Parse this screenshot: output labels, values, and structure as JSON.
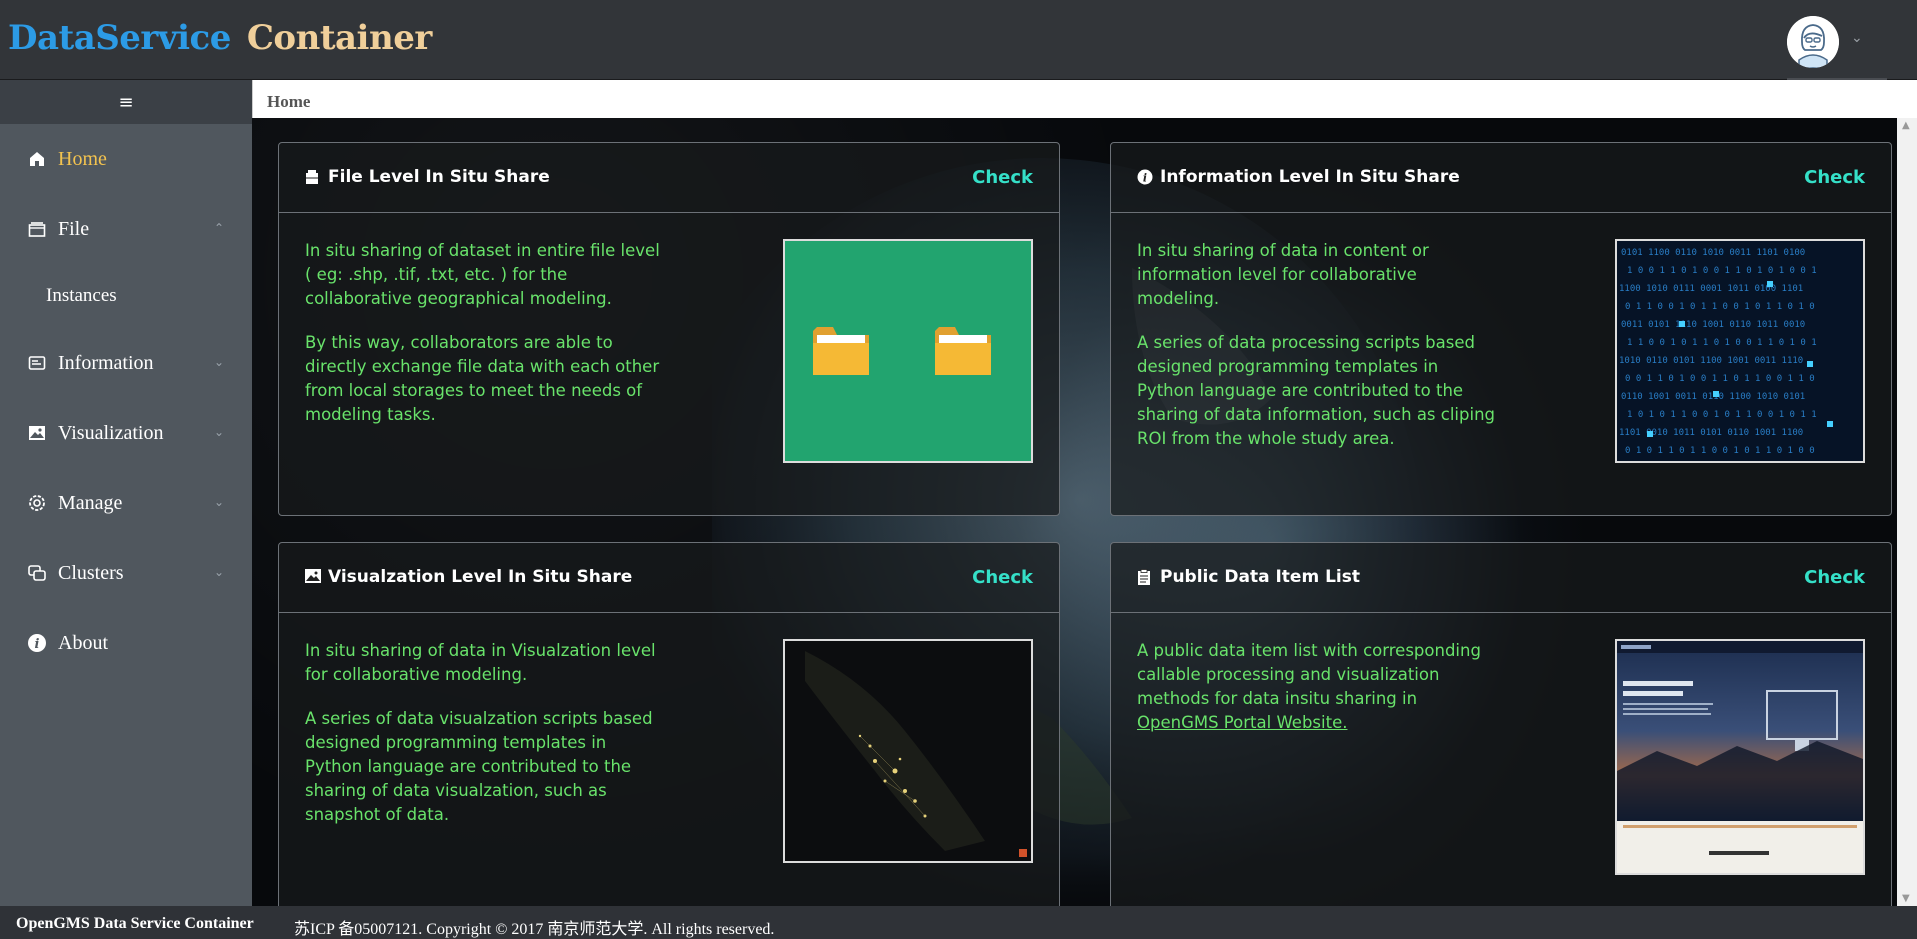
{
  "header": {
    "brand_part1": "DataService",
    "brand_part2": "Container",
    "avatar": "user-avatar",
    "dropdown_icon": "chevron-down-icon"
  },
  "sidebar": {
    "collapse_icon": "menu-icon",
    "items": [
      {
        "label": "Home",
        "icon": "home-icon",
        "active": true
      },
      {
        "label": "File",
        "icon": "file-icon",
        "expanded": true
      },
      {
        "label": "Instances",
        "sub": true
      },
      {
        "label": "Information",
        "icon": "information-icon"
      },
      {
        "label": "Visualization",
        "icon": "image-icon"
      },
      {
        "label": "Manage",
        "icon": "gear-icon"
      },
      {
        "label": "Clusters",
        "icon": "clusters-icon"
      },
      {
        "label": "About",
        "icon": "info-icon"
      }
    ]
  },
  "breadcrumb": {
    "label": "Home"
  },
  "cards": [
    {
      "title": "File Level In Situ Share",
      "icon": "file-share-icon",
      "check": "Check",
      "paragraphs": [
        "In situ sharing of dataset in entire file level ( eg: .shp, .tif, .txt, etc. ) for the collaborative geographical modeling.",
        "By this way, collaborators are able to directly exchange file data with each other from local storages to meet the needs of modeling tasks."
      ],
      "image": "two-folders-illustration"
    },
    {
      "title": "Information Level In Situ Share",
      "icon": "info-circle-icon",
      "check": "Check",
      "paragraphs": [
        "In situ sharing of data in content or information level for collaborative modeling.",
        "A series of data processing scripts based designed programming templates in Python language are contributed to the sharing of data information, such as cliping ROI from the whole study area."
      ],
      "image": "binary-code-illustration"
    },
    {
      "title": "Visualzation Level In Situ Share",
      "icon": "picture-icon",
      "check": "Check",
      "paragraphs": [
        "In situ sharing of data in Visualzation level for collaborative modeling.",
        "A series of data visualzation scripts based designed programming templates in Python language are contributed to the sharing of data visualzation, such as snapshot of data."
      ],
      "image": "night-map-illustration"
    },
    {
      "title": "Public Data Item List",
      "icon": "clipboard-icon",
      "check": "Check",
      "paragraph": "A public data item list with corresponding callable processing and visualization methods for data insitu sharing in",
      "link": "OpenGMS Portal Website.",
      "image": "opengms-portal-screenshot"
    }
  ],
  "footer": {
    "name": "OpenGMS Data Service Container",
    "copyright": "苏ICP 备05007121. Copyright © 2017 南京师范大学. All rights reserved."
  },
  "colors": {
    "brand_blue": "#2c9be6",
    "brand_gold": "#f0cf9a",
    "active_menu": "#f3c34f",
    "body_text": "#69e36b",
    "check_link": "#35e0c8",
    "sidebar_bg": "#50575e"
  }
}
